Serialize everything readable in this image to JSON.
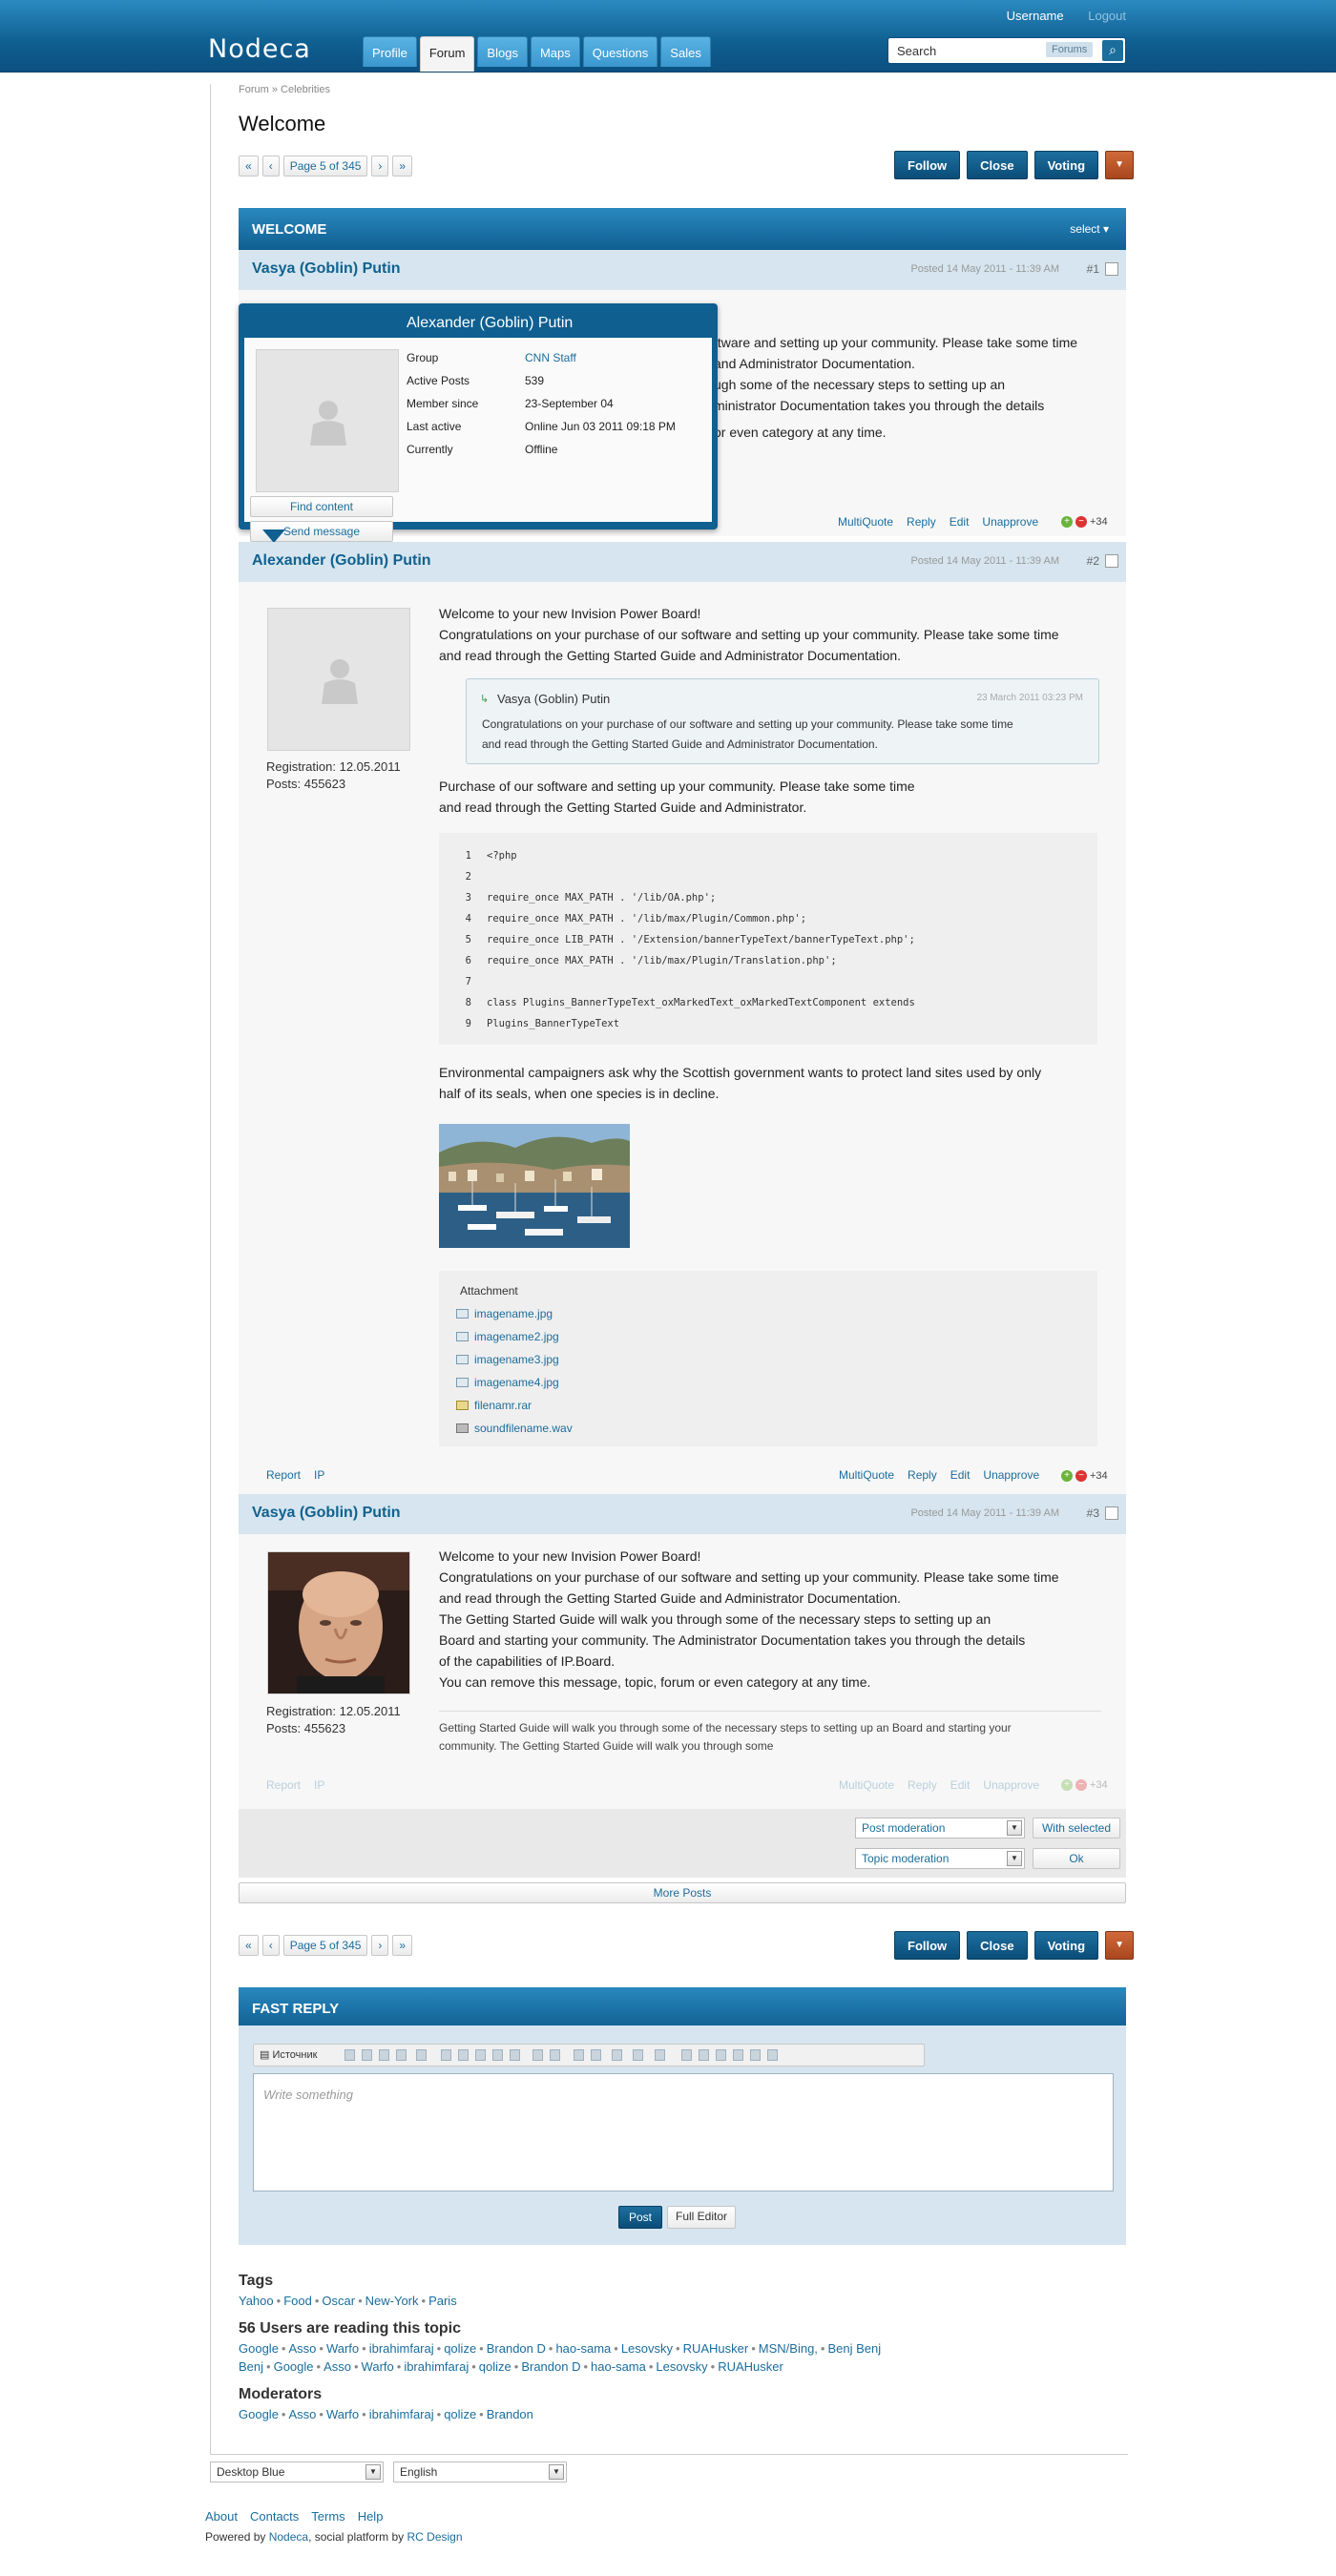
{
  "header": {
    "logo": "Nodeca",
    "username": "Username",
    "logout": "Logout",
    "tabs": [
      "Profile",
      "Forum",
      "Blogs",
      "Maps",
      "Questions",
      "Sales"
    ],
    "search_placeholder": "Search",
    "search_scope": "Forums"
  },
  "breadcrumb": "Forum » Celebrities",
  "page_title": "Welcome",
  "pager": {
    "first": "«",
    "prev": "‹",
    "label": "Page 5 of 345",
    "next": "›",
    "last": "»"
  },
  "actions": {
    "follow": "Follow",
    "close": "Close",
    "voting": "Voting"
  },
  "topic_bar": {
    "title": "WELCOME",
    "select": "select ▾"
  },
  "posts": [
    {
      "author": "Vasya (Goblin) Putin",
      "date": "Posted 14 May 2011 - 11:39 AM",
      "num": "#1",
      "lines": [
        "ftware and setting up your community. Please take some time",
        "and Administrator Documentation.",
        "ugh some of the necessary steps to setting up an",
        "ministrator Documentation takes you through the details",
        "or even category at any time."
      ]
    },
    {
      "author": "Alexander (Goblin) Putin",
      "date": "Posted 14 May 2011 - 11:39 AM",
      "num": "#2",
      "registration": "Registration: 12.05.2011",
      "posts_count": "Posts: 455623",
      "intro": [
        "Welcome to your new Invision Power Board!",
        "Congratulations on your purchase of our software and setting up your community. Please take some time",
        "and read through the Getting Started Guide and Administrator Documentation."
      ],
      "quote": {
        "author": "Vasya (Goblin) Putin",
        "date": "23 March 2011 03:23 PM",
        "lines": [
          "Congratulations on your purchase of our software and setting up your community. Please take some time",
          "and read through the Getting Started Guide and Administrator Documentation."
        ]
      },
      "para2": [
        "Purchase of our software and setting up your community. Please take some time",
        "and read through the Getting Started Guide and Administrator."
      ],
      "code": [
        [
          "1",
          "<?php"
        ],
        [
          "2",
          ""
        ],
        [
          "3",
          "require_once MAX_PATH . '/lib/OA.php';"
        ],
        [
          "4",
          "require_once MAX_PATH . '/lib/max/Plugin/Common.php';"
        ],
        [
          "5",
          "require_once LIB_PATH . '/Extension/bannerTypeText/bannerTypeText.php';"
        ],
        [
          "6",
          "require_once MAX_PATH . '/lib/max/Plugin/Translation.php';"
        ],
        [
          "7",
          ""
        ],
        [
          "8",
          "class Plugins_BannerTypeText_oxMarkedText_oxMarkedTextComponent extends"
        ],
        [
          "9",
          "Plugins_BannerTypeText"
        ]
      ],
      "para3": [
        "Environmental campaigners ask why the Scottish government wants to protect land sites used by only",
        "half of its seals, when one species is in decline."
      ],
      "attachment_title": "Attachment",
      "attachments": [
        "imagename.jpg",
        "imagename2.jpg",
        "imagename3.jpg",
        "imagename4.jpg",
        "filenamr.rar",
        "soundfilename.wav"
      ]
    },
    {
      "author": "Vasya (Goblin) Putin",
      "date": "Posted 14 May 2011 - 11:39 AM",
      "num": "#3",
      "registration": "Registration: 12.05.2011",
      "posts_count": "Posts: 455623",
      "lines": [
        "Welcome to your new Invision Power Board!",
        "Congratulations on your purchase of our software and setting up your community. Please take some time",
        "and read through the Getting Started Guide and Administrator Documentation.",
        "The Getting Started Guide will walk you through some of the necessary steps to setting up an",
        "Board and starting your community. The Administrator Documentation takes you through the details",
        "of the capabilities of IP.Board.",
        "You can remove this message, topic, forum or even category at any time."
      ],
      "signature": [
        "Getting Started Guide will walk you through some of the necessary steps to setting up an Board and starting your",
        "community. The Getting Started Guide will walk you through some"
      ]
    }
  ],
  "post_controls": {
    "multiquote": "MultiQuote",
    "reply": "Reply",
    "edit": "Edit",
    "unapprove": "Unapprove",
    "report": "Report",
    "ip": "IP",
    "rating": "+34",
    "plus": "+",
    "minus": "−"
  },
  "popup": {
    "name": "Alexander (Goblin) Putin",
    "rows": [
      [
        "Group",
        "CNN Staff"
      ],
      [
        "Active Posts",
        "539"
      ],
      [
        "Member since",
        "23-September 04"
      ],
      [
        "Last active",
        "Online Jun 03 2011 09:18 PM"
      ],
      [
        "Currently",
        "Offline"
      ]
    ],
    "find": "Find content",
    "send": "Send message"
  },
  "moderation": {
    "post_mod": "Post moderation",
    "topic_mod": "Topic moderation",
    "with_selected": "With selected",
    "ok": "Ok"
  },
  "more_posts": "More Posts",
  "fast_reply": {
    "title": "FAST REPLY",
    "source": "Источник",
    "placeholder": "Write something",
    "post": "Post",
    "full_editor": "Full Editor"
  },
  "tags": {
    "title": "Tags",
    "items": [
      "Yahoo",
      "Food",
      "Oscar",
      "New-York",
      "Paris"
    ]
  },
  "readers": {
    "title": "56 Users are reading this topic",
    "items": [
      "Google",
      "Asso",
      "Warfo",
      "ibrahimfaraj",
      "qolize",
      "Brandon D",
      "hao-sama",
      "Lesovsky",
      "RUAHusker",
      "MSN/Bing,",
      "Benj Benj Benj",
      "Google",
      "Asso",
      "Warfo",
      "ibrahimfaraj",
      "qolize",
      "Brandon D",
      "hao-sama",
      "Lesovsky",
      "RUAHusker"
    ]
  },
  "moderators": {
    "title": "Moderators",
    "items": [
      "Google",
      "Asso",
      "Warfo",
      "ibrahimfaraj",
      "qolize",
      "Brandon"
    ]
  },
  "footer": {
    "skin": "Desktop Blue",
    "language": "English",
    "links": [
      "About",
      "Contacts",
      "Terms",
      "Help"
    ],
    "powered_prefix": "Powered by",
    "nodeca": "Nodeca",
    "powered_mid": ", social platform by",
    "rc": "RC Design"
  },
  "colors": {
    "brand": "#0f5f90",
    "accent": "#1b6d9c",
    "voting_drop": "#c45a2c"
  }
}
